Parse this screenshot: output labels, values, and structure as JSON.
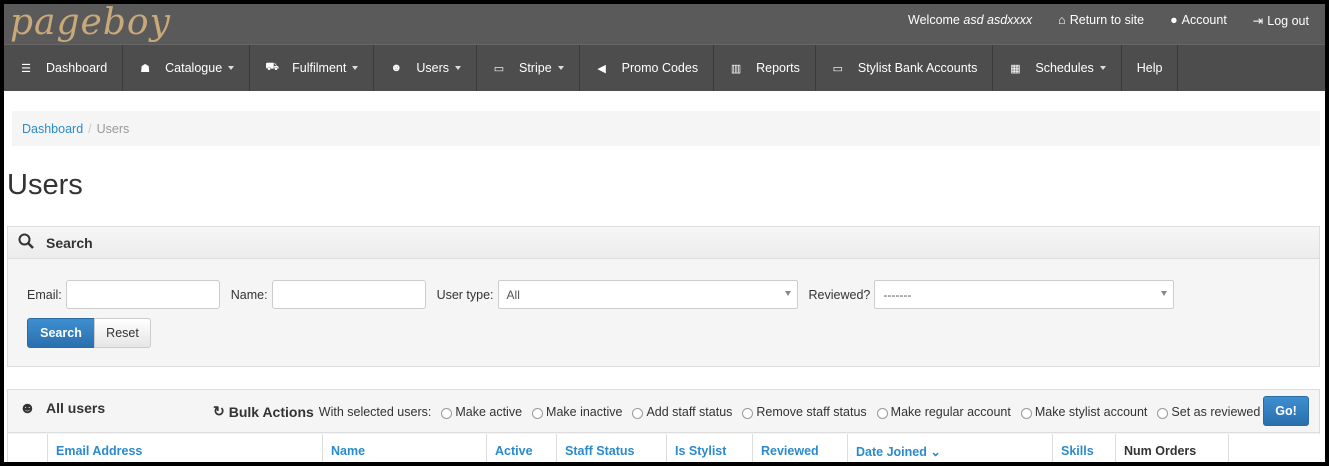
{
  "brand": {
    "logo_text": "pageboy"
  },
  "topbar": {
    "welcome_prefix": "Welcome",
    "welcome_user": "asd asdxxxx",
    "links": [
      {
        "icon": "home-icon",
        "label": "Return to site"
      },
      {
        "icon": "user-icon",
        "label": "Account"
      },
      {
        "icon": "logout-icon",
        "label": "Log out"
      }
    ]
  },
  "nav": {
    "items": [
      {
        "label": "Dashboard",
        "icon": "list-icon",
        "dropdown": false
      },
      {
        "label": "Catalogue",
        "icon": "sitemap-icon",
        "dropdown": true
      },
      {
        "label": "Fulfilment",
        "icon": "cart-icon",
        "dropdown": true
      },
      {
        "label": "Users",
        "icon": "users-icon",
        "dropdown": true
      },
      {
        "label": "Stripe",
        "icon": "credit-card-icon",
        "dropdown": true
      },
      {
        "label": "Promo Codes",
        "icon": "bullhorn-icon",
        "dropdown": false
      },
      {
        "label": "Reports",
        "icon": "bar-chart-icon",
        "dropdown": false
      },
      {
        "label": "Stylist Bank Accounts",
        "icon": "credit-card-icon",
        "dropdown": false
      },
      {
        "label": "Schedules",
        "icon": "calendar-icon",
        "dropdown": true
      },
      {
        "label": "Help",
        "icon": "",
        "dropdown": false
      }
    ]
  },
  "breadcrumb": {
    "home": "Dashboard",
    "separator": "/",
    "current": "Users"
  },
  "page": {
    "title": "Users"
  },
  "search": {
    "heading": "Search",
    "email_label": "Email:",
    "email_value": "",
    "name_label": "Name:",
    "name_value": "",
    "user_type_label": "User type:",
    "user_type_value": "All",
    "reviewed_label": "Reviewed?",
    "reviewed_value": "-------",
    "search_button": "Search",
    "reset_button": "Reset"
  },
  "users": {
    "heading": "All users",
    "bulk_title": "Bulk Actions",
    "bulk_subtitle": "With selected users:",
    "bulk_options": [
      "Make active",
      "Make inactive",
      "Add staff status",
      "Remove staff status",
      "Make regular account",
      "Make stylist account",
      "Set as reviewed"
    ],
    "go_button": "Go!",
    "columns": [
      "Email Address",
      "Name",
      "Active",
      "Staff Status",
      "Is Stylist",
      "Reviewed",
      "Date Joined",
      "Skills",
      "Num Orders"
    ]
  }
}
